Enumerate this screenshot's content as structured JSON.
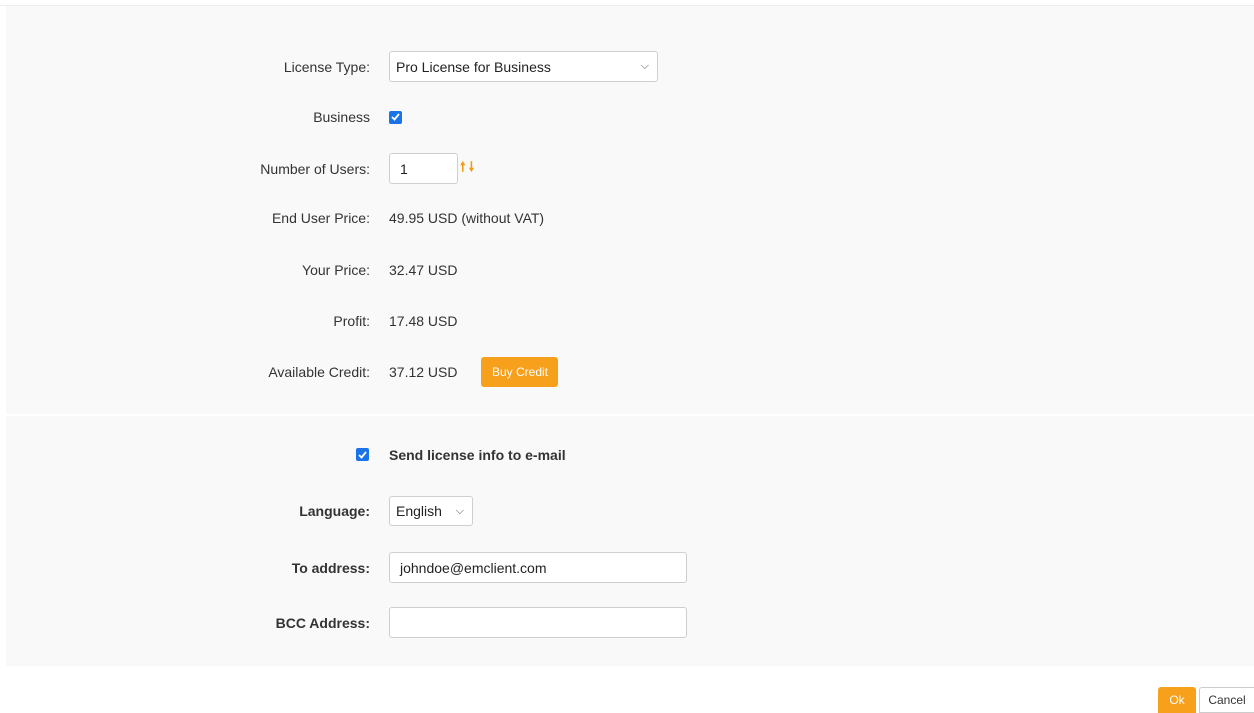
{
  "license": {
    "type_label": "License Type:",
    "type_value": "Pro License for Business",
    "business_label": "Business",
    "business_checked": true,
    "users_label": "Number of Users:",
    "users_value": "1",
    "end_price_label": "End User Price:",
    "end_price_value": "49.95 USD (without VAT)",
    "your_price_label": "Your Price:",
    "your_price_value": "32.47 USD",
    "profit_label": "Profit:",
    "profit_value": "17.48 USD",
    "credit_label": "Available Credit:",
    "credit_value": "37.12 USD",
    "buy_credit_label": "Buy Credit"
  },
  "email": {
    "send_label": "Send license info to e-mail",
    "send_checked": true,
    "language_label": "Language:",
    "language_value": "English",
    "to_label": "To address:",
    "to_value": "johndoe@emclient.com",
    "bcc_label": "BCC Address:",
    "bcc_value": ""
  },
  "footer": {
    "ok_label": "Ok",
    "cancel_label": "Cancel"
  },
  "colors": {
    "accent": "#f7a01c",
    "checkbox": "#1a73e8"
  }
}
